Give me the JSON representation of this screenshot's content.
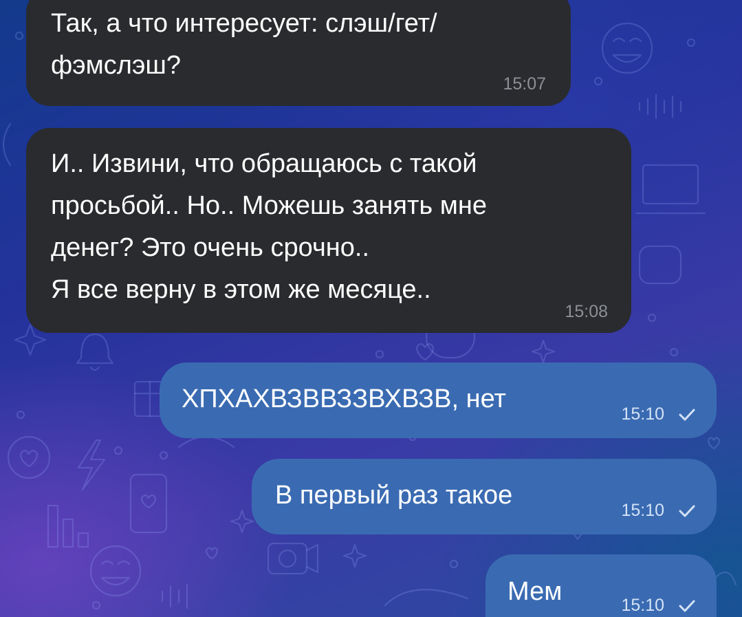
{
  "chat": {
    "messages": [
      {
        "direction": "incoming",
        "lines": [
          "Так, а что интересует: слэш/гет/",
          "фэмслэш?"
        ],
        "time": "15:07"
      },
      {
        "direction": "incoming",
        "lines": [
          "И.. Извини, что обращаюсь с такой",
          "просьбой.. Но.. Можешь занять мне",
          "денег? Это очень срочно..",
          "Я все верну в этом же месяце.."
        ],
        "time": "15:08"
      },
      {
        "direction": "outgoing",
        "lines": [
          "ХПХАХВЗВВЗЗВХВЗВ, нет"
        ],
        "time": "15:10",
        "status": "sent"
      },
      {
        "direction": "outgoing",
        "lines": [
          "В первый раз такое"
        ],
        "time": "15:10",
        "status": "sent"
      },
      {
        "direction": "outgoing",
        "lines": [
          "Мем"
        ],
        "time": "15:10",
        "status": "sent"
      }
    ]
  },
  "icons": {
    "read_receipt": "single-check-icon",
    "wallpaper_doodles": [
      "laughing-emoji-icon",
      "heart-icon",
      "bell-icon",
      "gift-icon",
      "lightning-icon",
      "phone-icon",
      "sparkle-icon",
      "bar-chart-icon",
      "laptop-icon",
      "camera-icon"
    ]
  },
  "colors": {
    "incoming_bubble": "#2a2b2e",
    "outgoing_bubble": "#3a6bb2",
    "incoming_time": "#8c8f95",
    "outgoing_time": "#d4e2f6",
    "text": "#ffffff"
  }
}
